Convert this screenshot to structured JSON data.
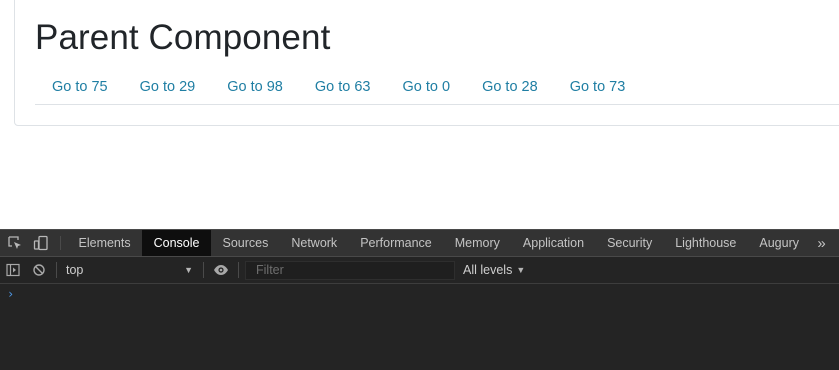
{
  "app": {
    "title": "Parent Component",
    "nav_links": [
      "Go to 75",
      "Go to 29",
      "Go to 98",
      "Go to 63",
      "Go to 0",
      "Go to 28",
      "Go to 73"
    ]
  },
  "devtools": {
    "icons": {
      "inspect": "inspect-element-icon",
      "device": "device-toolbar-icon"
    },
    "tabs": [
      "Elements",
      "Console",
      "Sources",
      "Network",
      "Performance",
      "Memory",
      "Application",
      "Security",
      "Lighthouse",
      "Augury"
    ],
    "active_tab": "Console",
    "more_tabs_glyph": "»",
    "toolbar": {
      "context": "top",
      "filter_placeholder": "Filter",
      "filter_value": "",
      "levels": "All levels",
      "levels_caret": "▼"
    },
    "console_prompt": "›"
  },
  "colors": {
    "link": "#1f7ea3",
    "title": "#212529",
    "devtools_bg": "#242424",
    "devtools_tabbar": "#333333",
    "active_tab_bg": "#0e0e0e",
    "prompt": "#4e98e6"
  }
}
